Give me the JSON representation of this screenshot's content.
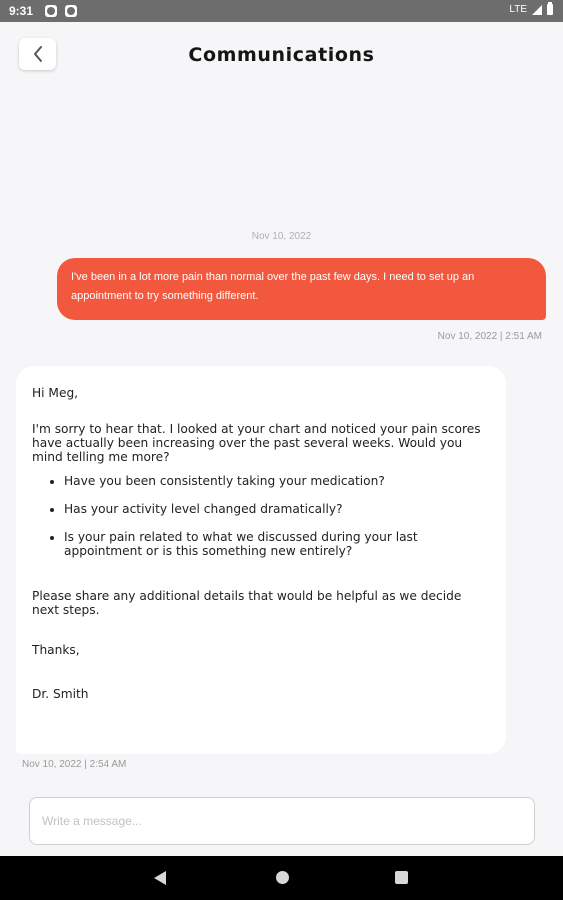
{
  "status_bar": {
    "time": "9:31",
    "network": "LTE",
    "icons": [
      "notification-icon",
      "notification-icon",
      "signal-icon",
      "battery-icon"
    ]
  },
  "header": {
    "title": "Communications",
    "back_icon": "chevron-left-icon"
  },
  "thread": {
    "date_divider": "Nov 10, 2022",
    "outgoing": {
      "text": "I've been in a lot more pain than normal over the past few days. I need to set up an appointment to try something different.",
      "meta": "Nov 10, 2022 | 2:51 AM",
      "color": "#f2583e"
    },
    "incoming": {
      "greeting": "Hi Meg,",
      "intro": "I'm sorry to hear that. I looked at your chart and noticed your pain scores have actually been increasing over the past several weeks. Would you mind telling me more?",
      "questions": [
        "Have you been consistently taking your medication?",
        "Has your activity level changed dramatically?",
        "Is your pain related to what we discussed during your last appointment or is this something new entirely?"
      ],
      "closing": "Please share any additional details that would be helpful as we decide next steps.",
      "thanks": "Thanks,",
      "signature": "Dr. Smith",
      "meta": "Nov 10, 2022 | 2:54 AM"
    }
  },
  "composer": {
    "placeholder": "Write a message..."
  },
  "nav_bar": {
    "icons": [
      "nav-back-icon",
      "nav-home-icon",
      "nav-recents-icon"
    ]
  }
}
